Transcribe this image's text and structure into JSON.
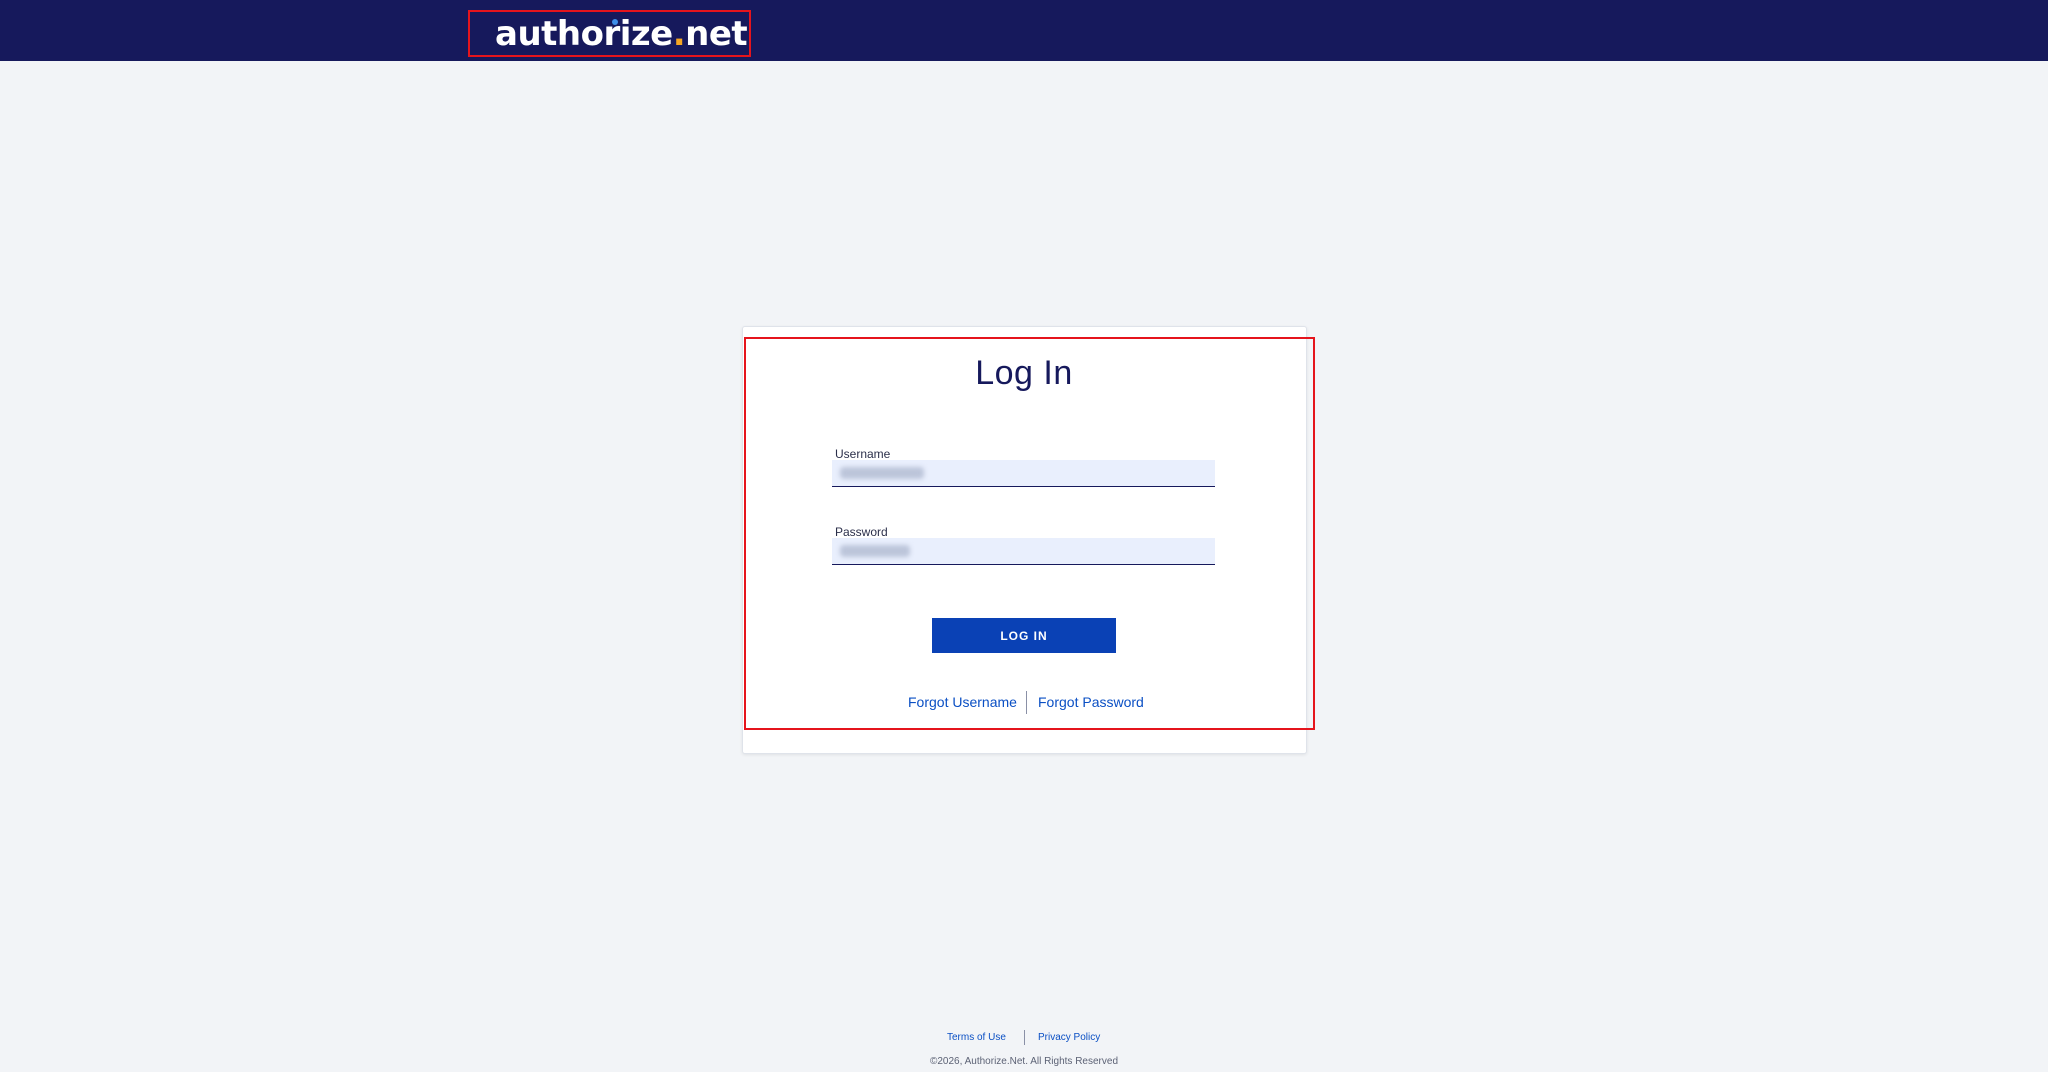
{
  "header": {
    "logo_text": "authorize",
    "logo_dot": ".",
    "logo_tld": "net"
  },
  "login": {
    "title": "Log In",
    "username_label": "Username",
    "password_label": "Password",
    "login_button": "LOG IN",
    "forgot_username": "Forgot Username",
    "forgot_password": "Forgot Password"
  },
  "footer": {
    "terms": "Terms of Use",
    "privacy": "Privacy Policy",
    "copyright": "©2026, Authorize.Net. All Rights Reserved"
  },
  "colors": {
    "header_bg": "#16195c",
    "button_bg": "#0a41b5",
    "link": "#0a4fc4",
    "logo_dot_accent": "#f5a623",
    "highlight": "#e5141c"
  }
}
